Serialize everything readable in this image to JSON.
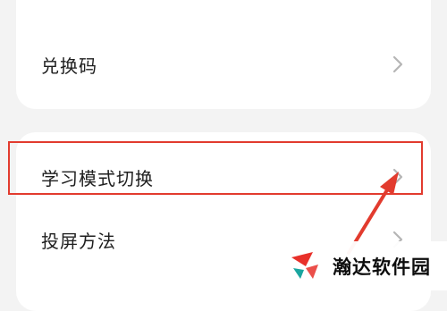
{
  "settings_list": {
    "redeem_code": {
      "label": "兑换码",
      "icon": "chevron-right-icon"
    },
    "study_mode_switch": {
      "label": "学习模式切换",
      "icon": "chevron-right-icon"
    },
    "screen_cast_method": {
      "label": "投屏方法",
      "icon": "chevron-right-icon"
    }
  },
  "annotation": {
    "highlight_color": "#e23b2e",
    "highlighted_item": "学习模式切换"
  },
  "watermark": {
    "text": "瀚达软件园",
    "logo_colors": [
      "#e8302a",
      "#1aa6a0"
    ]
  },
  "colors": {
    "background": "#f3f3f3",
    "card": "#ffffff",
    "chevron": "#b5b5b5"
  }
}
